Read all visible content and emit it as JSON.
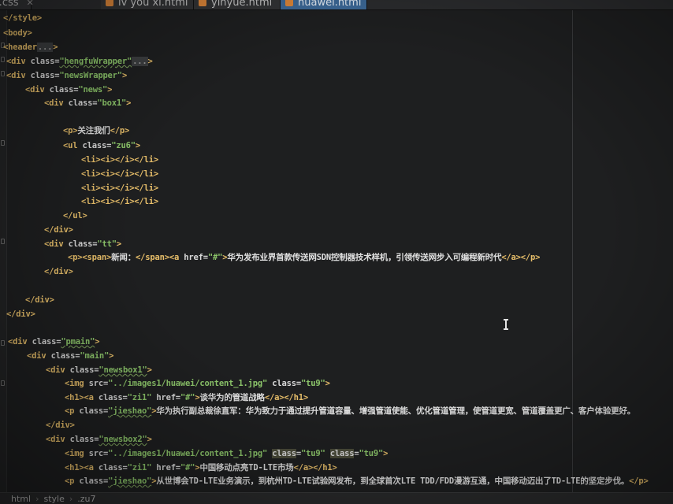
{
  "tabs": [
    {
      "label": "huawei.css",
      "color": "#4f8fd6"
    },
    {
      "label": "lv you xi.html",
      "color": "#e0883a"
    },
    {
      "label": "yinyue.html",
      "color": "#e0883a"
    },
    {
      "label": "huawei.html",
      "color": "#e0883a",
      "active": true
    }
  ],
  "code": {
    "l1": "</style>",
    "l2": "<body>",
    "l3_tag": "<header",
    "l3_fold": "...",
    "l3_end": ">",
    "l4_open": "<div ",
    "l4_attr": "class=",
    "l4_val": "\"hengfuWrapper\"",
    "l4_fold": "...",
    "l4_end": ">",
    "l5_open": "<div ",
    "l5_attr": "class=",
    "l5_val": "\"newsWrapper\"",
    "l5_end": ">",
    "l6_open": "<div ",
    "l6_attr": "class=",
    "l6_val": "\"news\"",
    "l6_end": ">",
    "l7_open": "<div ",
    "l7_attr": "class=",
    "l7_val": "\"box1\"",
    "l7_end": ">",
    "l8_open": "<p>",
    "l8_text": "关注我们",
    "l8_close": "</p>",
    "l9_open": "<ul ",
    "l9_attr": "class=",
    "l9_val": "\"zu6\"",
    "l9_end": ">",
    "li": "<li><i></i></li>",
    "l14": "</ul>",
    "l15": "</div>",
    "l16_open": "<div ",
    "l16_attr": "class=",
    "l16_val": "\"tt\"",
    "l16_end": ">",
    "l17_a": "<p><span>",
    "l17_b": "新闻：",
    "l17_c": "</span><a ",
    "l17_d": "href=",
    "l17_e": "\"#\"",
    "l17_f": ">",
    "l17_g": "华为发布业界首款传送网SDN控制器技术样机，引领传送网步入可编程新时代",
    "l17_h": "</a></p>",
    "l18": "</div>",
    "l19": "</div>",
    "l20": "</div>",
    "l21_open": "<div ",
    "l21_attr": "class=",
    "l21_val": "\"pmain\"",
    "l21_end": ">",
    "l22_open": "<div ",
    "l22_attr": "class=",
    "l22_val": "\"main\"",
    "l22_end": ">",
    "l23_open": "<div ",
    "l23_attr": "class=",
    "l23_val": "\"newsbox1\"",
    "l23_end": ">",
    "l24_open": "<img ",
    "l24_attr1": "src=",
    "l24_val1": "\"../images1/huawei/content_1.jpg\"",
    "l24_attr2": " class=",
    "l24_val2": "\"tu9\"",
    "l24_end": ">",
    "l25_open": "<h1><a ",
    "l25_attr1": "class=",
    "l25_val1": "\"zi1\"",
    "l25_attr2": " href=",
    "l25_val2": "\"#\"",
    "l25_end": ">",
    "l25_text": "谈华为的管道战略",
    "l25_close": "</a></h1>",
    "l26_open": "<p ",
    "l26_attr": "class=",
    "l26_val": "\"jieshao\"",
    "l26_end": ">",
    "l26_text": "华为执行副总裁徐直军：华为致力于通过提升管道容量、增强管道使能、优化管道管理，使管道更宽、管道覆盖更广、客户体验更好。",
    "l27": "</div>",
    "l28_open": "<div ",
    "l28_attr": "class=",
    "l28_val": "\"newsbox2\"",
    "l28_end": ">",
    "l29_open": "<img ",
    "l29_attr1": "src=",
    "l29_val1": "\"../images1/huawei/content_1.jpg\"",
    "l29_attr2": "class",
    "l29_eq2": "=",
    "l29_val2": "\"tu9\"",
    "l29_attr3": "class",
    "l29_eq3": "=",
    "l29_val3": "\"tu9\"",
    "l29_end": ">",
    "l30_open": "<h1><a ",
    "l30_attr1": "class=",
    "l30_val1": "\"zi1\"",
    "l30_attr2": " href=",
    "l30_val2": "\"#\"",
    "l30_end": ">",
    "l30_text": "中国移动点亮TD-LTE市场",
    "l30_close": "</a></h1>",
    "l31_open": "<p ",
    "l31_attr": "class=",
    "l31_val": "\"jieshao\"",
    "l31_end": ">",
    "l31_text": "从世博会TD-LTE业务演示，到杭州TD-LTE试验网发布，到全球首次LTE TDD/FDD漫游互通，中国移动迈出了TD-LTE的坚定步伐。",
    "l31_close": "</p>"
  },
  "statusbar": {
    "crumb1": "html",
    "crumb2": "style",
    "crumb3": ".zu7"
  }
}
